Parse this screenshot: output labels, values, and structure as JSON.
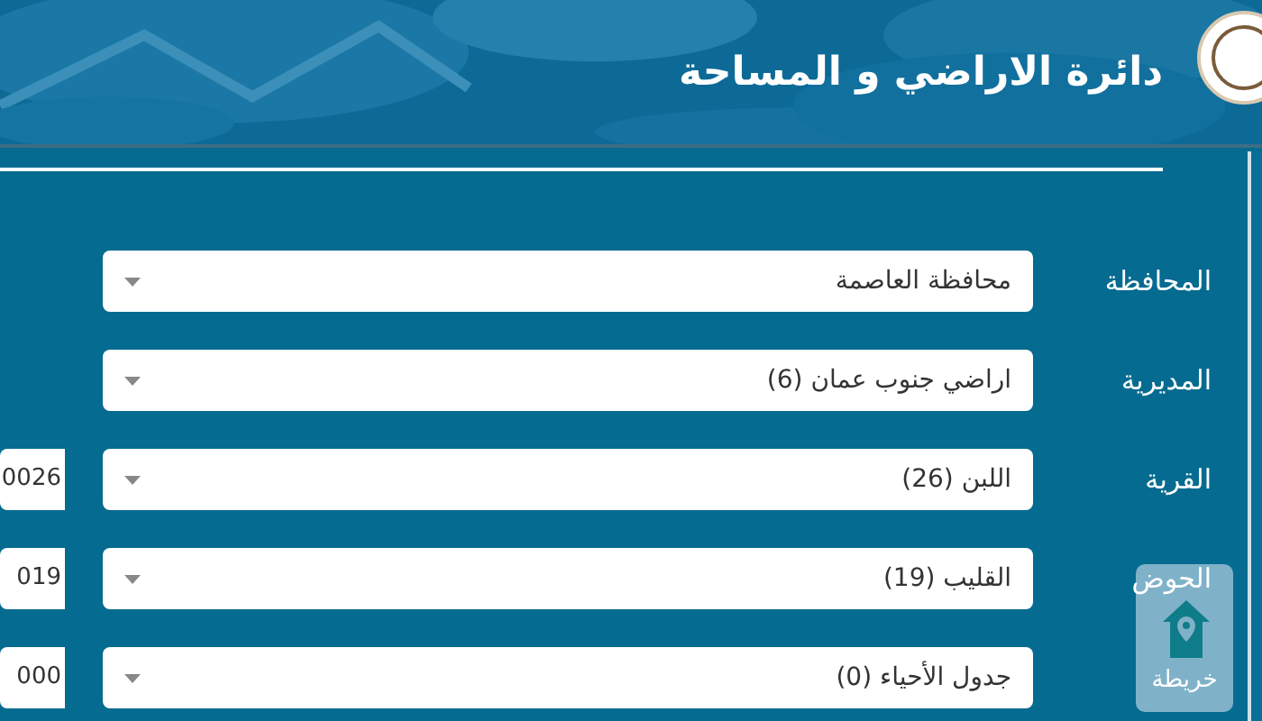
{
  "header": {
    "title": "دائرة الاراضي و المساحة"
  },
  "fields": [
    {
      "label": "المحافظة",
      "value": "محافظة العاصمة"
    },
    {
      "label": "المديرية",
      "value": "اراضي جنوب عمان (6)"
    },
    {
      "label": "القرية",
      "value": "اللبن (26)",
      "code": "0026"
    },
    {
      "label": "الحوض",
      "value": "القليب (19)",
      "code": "019"
    },
    {
      "value": "جدول الأحياء (0)",
      "code": "000"
    }
  ],
  "map_button": {
    "label": "خريطة"
  }
}
